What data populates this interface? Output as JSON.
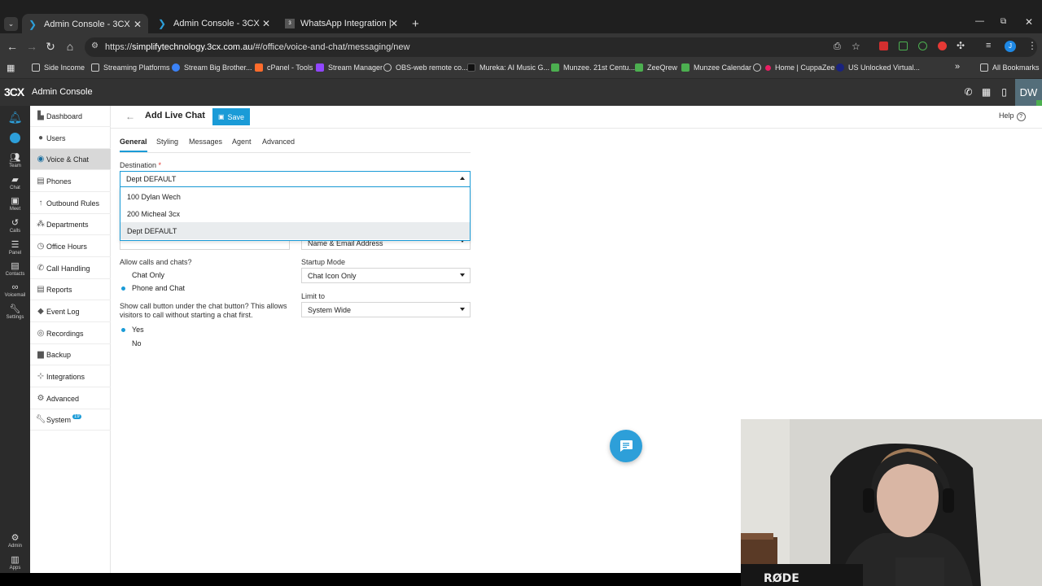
{
  "browser": {
    "tabs": [
      {
        "title": "Admin Console - 3CX",
        "active": true
      },
      {
        "title": "Admin Console - 3CX",
        "active": false
      },
      {
        "title": "WhatsApp Integration | 3CX Co",
        "active": false
      }
    ],
    "url_host": "simplifytechnology.3cx.com.au",
    "url_path": "/#/office/voice-and-chat/messaging/new",
    "url_scheme": "https://",
    "bookmarks": [
      "Side Income",
      "Streaming Platforms",
      "Stream Big Brother...",
      "cPanel - Tools",
      "Stream Manager",
      "OBS-web remote co...",
      "Mureka: AI Music G...",
      "Munzee. 21st Centu...",
      "ZeeQrew",
      "Munzee Calendar",
      "Home | CuppaZee",
      "US Unlocked Virtual..."
    ],
    "all_bookmarks": "All Bookmarks",
    "profile_initial": "J"
  },
  "app": {
    "logo": "3CX",
    "title": "Admin Console",
    "user_initials": "DW"
  },
  "rail": [
    "Team",
    "Chat",
    "Meet",
    "Calls",
    "Panel",
    "Contacts",
    "Voicemail",
    "Settings"
  ],
  "rail_bottom": [
    "Admin",
    "Apps"
  ],
  "menu": [
    {
      "label": "Dashboard",
      "icon": "dashboard-icon"
    },
    {
      "label": "Users",
      "icon": "user-icon"
    },
    {
      "label": "Voice & Chat",
      "icon": "globe-icon",
      "active": true
    },
    {
      "label": "Phones",
      "icon": "phone-device-icon"
    },
    {
      "label": "Outbound Rules",
      "icon": "arrow-up-icon"
    },
    {
      "label": "Departments",
      "icon": "group-icon"
    },
    {
      "label": "Office Hours",
      "icon": "clock-icon"
    },
    {
      "label": "Call Handling",
      "icon": "phone-icon"
    },
    {
      "label": "Reports",
      "icon": "report-icon"
    },
    {
      "label": "Event Log",
      "icon": "event-icon"
    },
    {
      "label": "Recordings",
      "icon": "record-icon"
    },
    {
      "label": "Backup",
      "icon": "backup-icon"
    },
    {
      "label": "Integrations",
      "icon": "integrations-icon"
    },
    {
      "label": "Advanced",
      "icon": "gear-icon"
    },
    {
      "label": "System",
      "icon": "wrench-icon",
      "badge": "19"
    }
  ],
  "page": {
    "title": "Add Live Chat",
    "save_label": "Save",
    "help_label": "Help",
    "tabs": [
      "General",
      "Styling",
      "Messages",
      "Agent",
      "Advanced"
    ],
    "active_tab": "General",
    "destination": {
      "label": "Destination",
      "required_mark": "*",
      "value": "Dept DEFAULT",
      "options": [
        "100 Dylan Wech",
        "200 Micheal 3cx",
        "Dept DEFAULT"
      ],
      "selected": "Dept DEFAULT"
    },
    "partial_field_value": "Name & Email Address",
    "allow_calls": {
      "label": "Allow calls and chats?",
      "options": [
        "Chat Only",
        "Phone and Chat"
      ],
      "selected": "Phone and Chat"
    },
    "show_call_button": {
      "label": "Show call button under the chat button? This allows visitors to call without starting a chat first.",
      "options": [
        "Yes",
        "No"
      ],
      "selected": "Yes"
    },
    "startup_mode": {
      "label": "Startup Mode",
      "value": "Chat Icon Only"
    },
    "limit_to": {
      "label": "Limit to",
      "value": "System Wide"
    }
  },
  "colors": {
    "accent": "#1a9bd7",
    "header_bg": "#323232",
    "rail_bg": "#2b2b2b",
    "active_menu_bg": "#d8d8d8"
  }
}
